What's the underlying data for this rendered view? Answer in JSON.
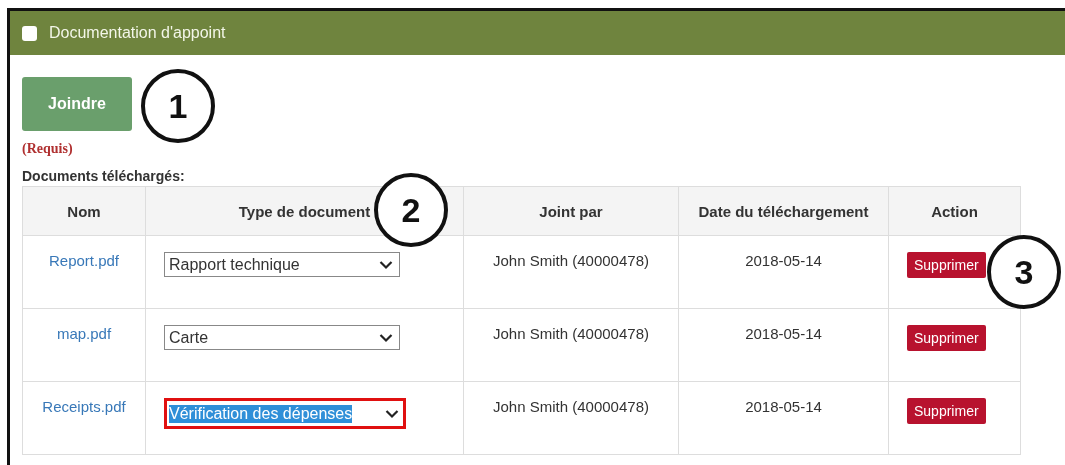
{
  "panel": {
    "title": "Documentation d'appoint",
    "checked": false
  },
  "attach_button": "Joindre",
  "required_note": "(Requis)",
  "section_label": "Documents téléchargés:",
  "table": {
    "columns": [
      "Nom",
      "Type de document",
      "Joint par",
      "Date du téléchargement",
      "Action"
    ],
    "rows": [
      {
        "name": "Report.pdf",
        "doc_type": "Rapport technique",
        "focused": false,
        "joined_by": "John Smith (40000478)",
        "date": "2018-05-14",
        "action": "Supprimer"
      },
      {
        "name": "map.pdf",
        "doc_type": "Carte",
        "focused": false,
        "joined_by": "John Smith (40000478)",
        "date": "2018-05-14",
        "action": "Supprimer"
      },
      {
        "name": "Receipts.pdf",
        "doc_type": "Vérification des dépenses",
        "focused": true,
        "joined_by": "John Smith (40000478)",
        "date": "2018-05-14",
        "action": "Supprimer"
      }
    ]
  },
  "callouts": [
    "1",
    "2",
    "3"
  ]
}
